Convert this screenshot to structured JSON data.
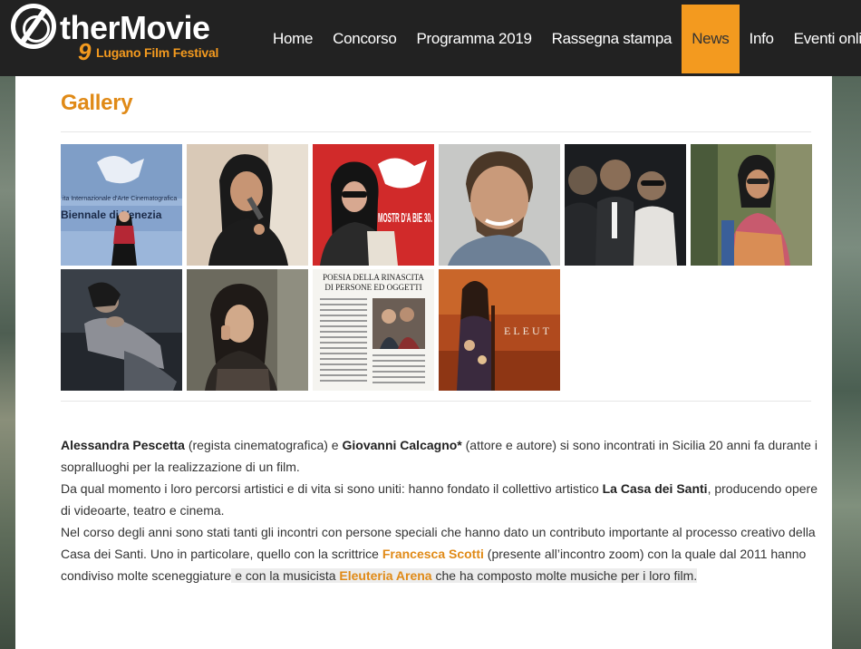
{
  "header": {
    "logo_title": "therMovie",
    "logo_number": "9",
    "logo_subtitle": "Lugano Film Festival",
    "nav": [
      {
        "label": "Home",
        "active": false
      },
      {
        "label": "Concorso",
        "active": false
      },
      {
        "label": "Programma 2019",
        "active": false
      },
      {
        "label": "Rassegna stampa",
        "active": false
      },
      {
        "label": "News",
        "active": true
      },
      {
        "label": "Info",
        "active": false
      },
      {
        "label": "Eventi online",
        "active": false
      }
    ],
    "accent_color": "#f39a1f"
  },
  "gallery": {
    "title": "Gallery",
    "thumbs": [
      {
        "caption": "Biennale di Venezia",
        "caption2": "ita Internazionale d'Arte Cinematografica"
      },
      {
        "caption": ""
      },
      {
        "caption": "MOSTR D'A BIE 30."
      },
      {
        "caption": ""
      },
      {
        "caption": ""
      },
      {
        "caption": ""
      },
      {
        "caption": ""
      },
      {
        "caption": ""
      },
      {
        "caption": "POESIA DELLA RINASCITA",
        "caption2": "DI PERSONE ED OGGETTI"
      },
      {
        "caption": "ELEUT"
      }
    ]
  },
  "article": {
    "p1_name1": "Alessandra Pescetta",
    "p1_t1": " (regista cinematografica) e ",
    "p1_name2": "Giovanni Calcagno*",
    "p1_t2": " (attore e autore) si sono incontrati in Sicilia 20 anni fa durante i sopralluoghi per la realizzazione di un film.",
    "p2_t1": "Da qual momento i loro percorsi artistici e di vita si sono uniti: hanno fondato il collettivo artistico ",
    "p2_name": "La Casa dei Santi",
    "p2_t2": ", producendo opere di videoarte, teatro e cinema.",
    "p3_t1": "Nel corso degli anni sono stati tanti gli incontri con persone speciali che hanno dato un contributo importante al processo creativo della Casa dei Santi. Uno in particolare, quello con la scrittrice ",
    "p3_name1": "Francesca Scotti",
    "p3_t2": " (presente all’incontro zoom) con la quale dal 2011 hanno condiviso molte sceneggiature",
    "p3_t3": " e con la musicista ",
    "p3_name2": "Eleuteria Arena",
    "p3_t4": " che ha composto molte musiche per i loro film.",
    "link_color": "#e08a17"
  }
}
